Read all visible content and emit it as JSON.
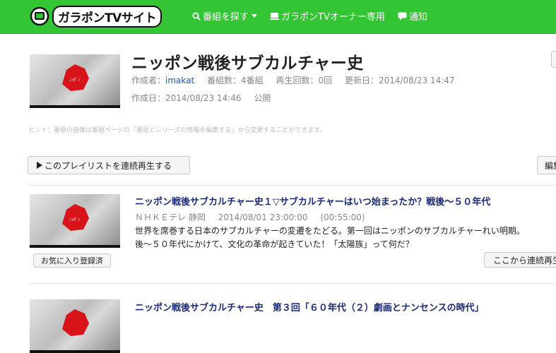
{
  "header": {
    "logo_text": "ガラポンTVサイト",
    "nav": [
      {
        "label": "番組を探す",
        "icon": "search-icon"
      },
      {
        "label": "ガラポンTVオーナー専用",
        "icon": "device-icon"
      },
      {
        "label": "通知",
        "icon": "comment-icon"
      }
    ]
  },
  "playlist": {
    "title": "ニッポン戦後サブカルチャー史",
    "creator_label": "作成者：",
    "creator": "imakat",
    "program_count": "番組数：4番組",
    "play_count": "再生回数：0回",
    "updated": "更新日：2014/08/23 14:47",
    "created": "作成日：2014/08/23 14:46",
    "visibility": "公開",
    "hint": "ヒント：番組の画像は番組ページの「番組とシリーズの情報を編集する」から変更することができます。",
    "play_all_label": "このプレイリストを連続再生する",
    "edit_label": "編集"
  },
  "episodes": [
    {
      "title": "ニッポン戦後サブカルチャー史１▽サブカルチャーはいつ始まったか？戦後～５０年代",
      "channel": "ＮＨＫＥテレ 静岡",
      "datetime": "2014/08/01 23:00:00",
      "duration": "(00:55:00)",
      "desc_line1": "世界を席巻する日本のサブカルチャーの変遷をたどる。第一回はニッポンのサブカルチャーれい明期。",
      "desc_line2": "後～５０年代にかけて、文化の革命が起きていた！「太陽族」って何だ？",
      "fav_label": "お気に入り登録済",
      "from_here_label": "ここから連続再生"
    },
    {
      "title": "ニッポン戦後サブカルチャー史　第３回「６０年代（２）劇画とナンセンスの時代」"
    }
  ],
  "colors": {
    "header_green": "#34c534",
    "title_navy": "#1a2a7a",
    "link_blue": "#2255aa"
  }
}
